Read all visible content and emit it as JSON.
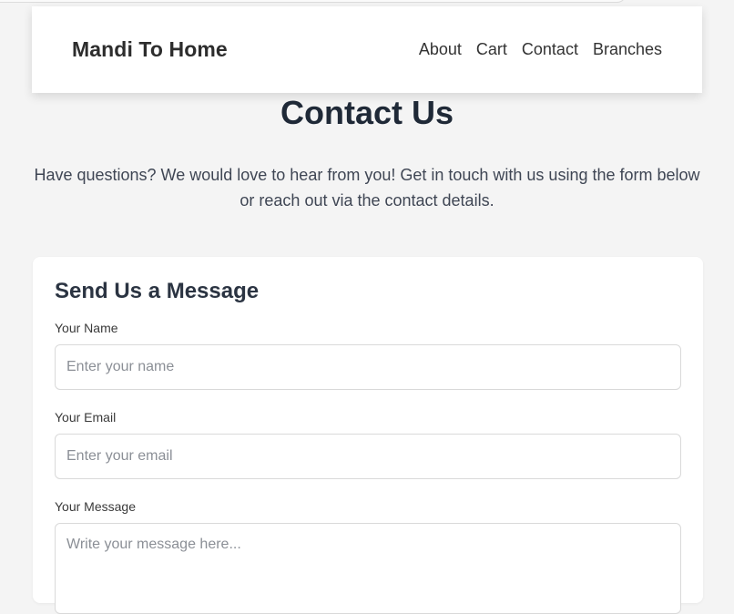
{
  "header": {
    "brand": "Mandi To Home",
    "nav": [
      {
        "label": "About"
      },
      {
        "label": "Cart"
      },
      {
        "label": "Contact"
      },
      {
        "label": "Branches"
      }
    ]
  },
  "main": {
    "title": "Contact Us",
    "intro": "Have questions? We would love to hear from you! Get in touch with us using the form below or reach out via the contact details."
  },
  "form": {
    "title": "Send Us a Message",
    "name_label": "Your Name",
    "name_placeholder": "Enter your name",
    "email_label": "Your Email",
    "email_placeholder": "Enter your email",
    "message_label": "Your Message",
    "message_placeholder": "Write your message here..."
  }
}
